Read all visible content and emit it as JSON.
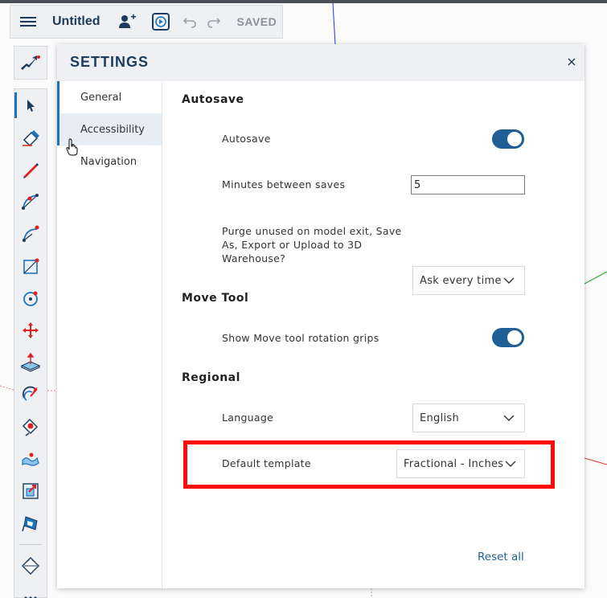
{
  "app": {
    "title": "Untitled",
    "save_status": "SAVED"
  },
  "toolbar": {
    "icons": [
      "hamburger-menu-icon",
      "add-user-icon",
      "present-icon",
      "undo-icon",
      "redo-icon"
    ]
  },
  "tools": [
    "select",
    "eraser",
    "pencil",
    "arc",
    "arc-2",
    "rectangle",
    "circle",
    "move",
    "push-pull",
    "rotate",
    "paint",
    "follow-me",
    "offset",
    "tape-measure",
    "more"
  ],
  "settings": {
    "title": "SETTINGS",
    "nav": [
      {
        "label": "General"
      },
      {
        "label": "Accessibility"
      },
      {
        "label": "Navigation"
      }
    ],
    "sections": {
      "autosave": {
        "title": "Autosave",
        "autosave_label": "Autosave",
        "autosave_on": true,
        "minutes_label": "Minutes between saves",
        "minutes_value": "5",
        "purge_label": "Purge unused on model exit, Save As, Export or Upload to 3D Warehouse?",
        "purge_value": "Ask every time"
      },
      "move_tool": {
        "title": "Move Tool",
        "grips_label": "Show Move tool rotation grips",
        "grips_on": true
      },
      "regional": {
        "title": "Regional",
        "language_label": "Language",
        "language_value": "English",
        "template_label": "Default template",
        "template_value": "Fractional - Inches"
      }
    },
    "reset_label": "Reset all"
  },
  "colors": {
    "accent": "#1e5f97",
    "highlight": "#ff0a0a",
    "brand": "#1d3b5e"
  }
}
